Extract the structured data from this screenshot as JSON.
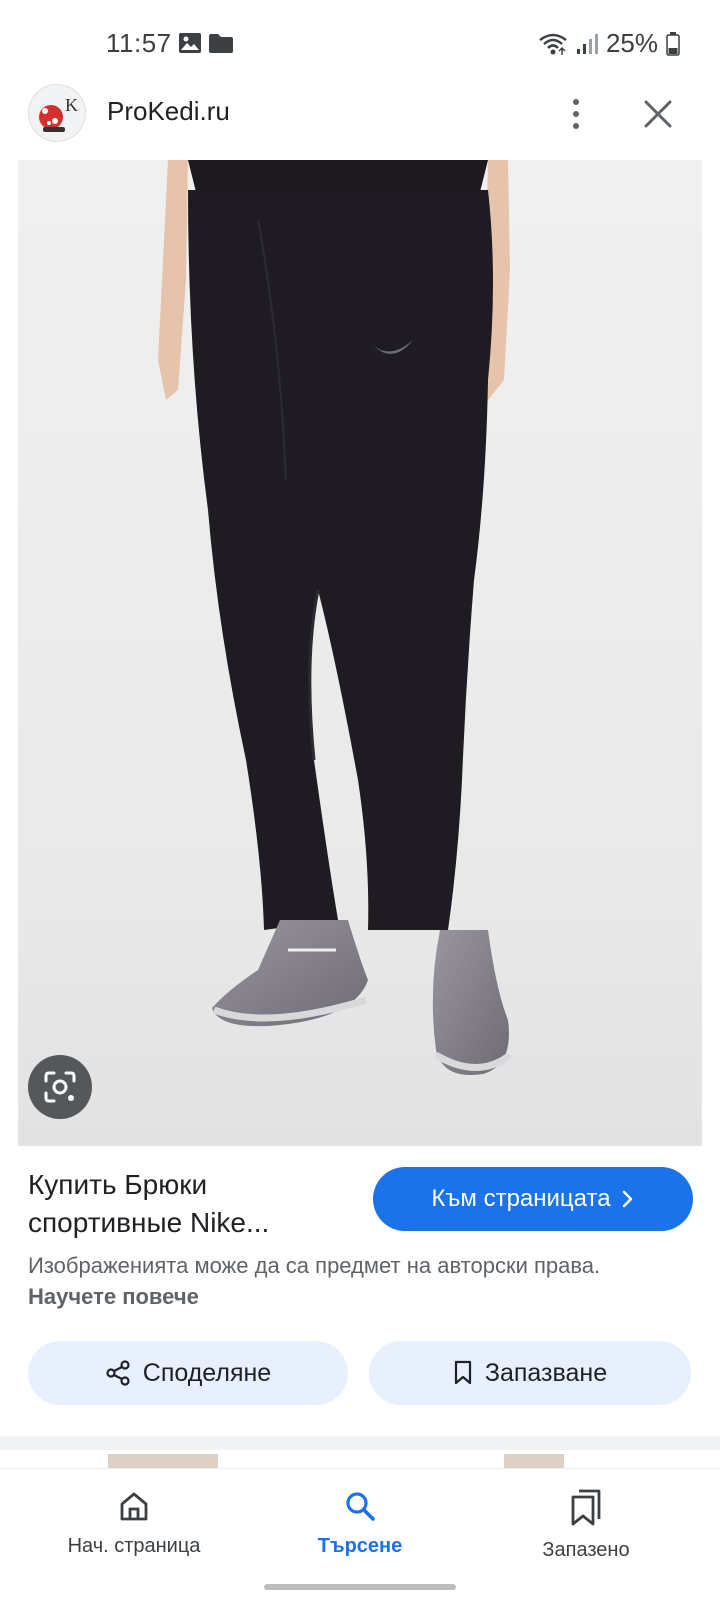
{
  "status_bar": {
    "time": "11:57",
    "battery": "25%",
    "icons": [
      "image-icon",
      "folder-icon",
      "wifi-icon",
      "signal-icon",
      "battery-icon"
    ]
  },
  "header": {
    "site_name": "ProKedi.ru",
    "logo_letter": "K",
    "more_icon": "more-vert-icon",
    "close_icon": "close-icon"
  },
  "result": {
    "title": "Купить Брюки спортивные Nike...",
    "visit_button": "Към страницата",
    "copyright_text": "Изображенията може да са предмет на авторски права.",
    "learn_more": "Научете повече",
    "share_button": "Споделяне",
    "save_button": "Запазване"
  },
  "bottom_nav": {
    "items": [
      {
        "label": "Нач. страница",
        "icon": "home-icon",
        "active": false
      },
      {
        "label": "Търсене",
        "icon": "search-icon",
        "active": true
      },
      {
        "label": "Запазено",
        "icon": "bookmarks-icon",
        "active": false
      }
    ]
  },
  "colors": {
    "accent": "#1a73e8",
    "button_bg": "#e8f0fe",
    "secondary_text": "#5f6368"
  }
}
